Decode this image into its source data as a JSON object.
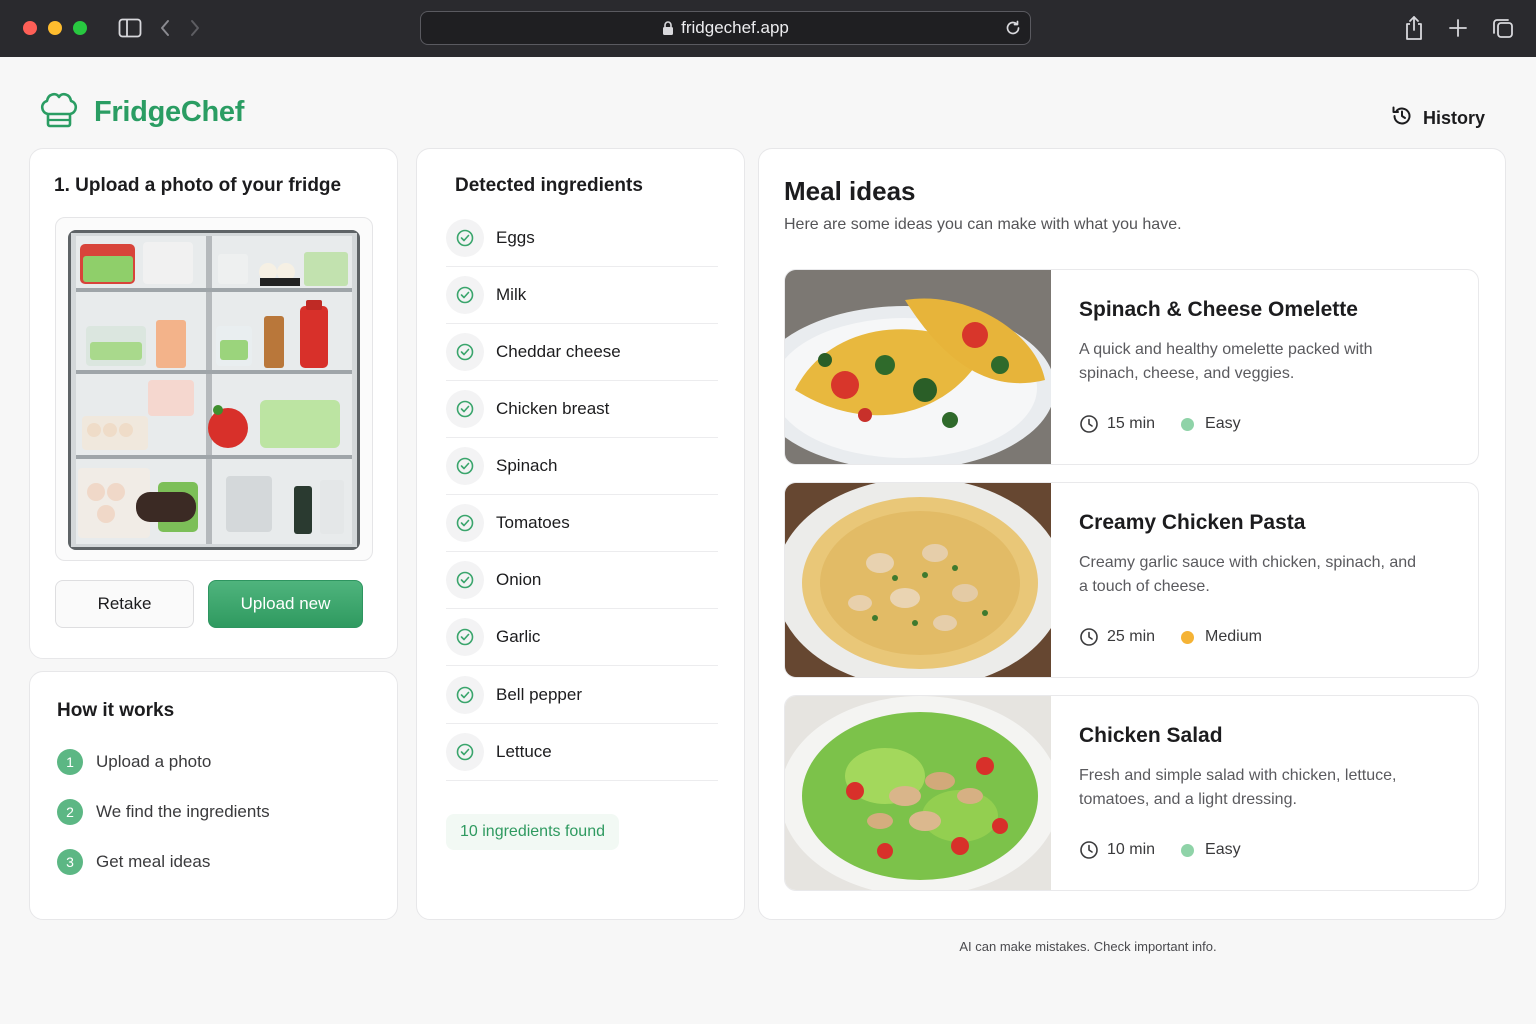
{
  "browser": {
    "url": "fridgechef.app"
  },
  "header": {
    "brand": "FridgeChef",
    "history_label": "History"
  },
  "upload": {
    "title": "1. Upload a photo of your fridge",
    "retake_label": "Retake",
    "upload_label": "Upload new"
  },
  "how": {
    "title": "How it works",
    "steps": [
      {
        "num": "1",
        "label": "Upload a photo"
      },
      {
        "num": "2",
        "label": "We find the ingredients"
      },
      {
        "num": "3",
        "label": "Get meal ideas"
      }
    ]
  },
  "ingredients": {
    "title": "Detected ingredients",
    "items": [
      "Eggs",
      "Milk",
      "Cheddar cheese",
      "Chicken breast",
      "Spinach",
      "Tomatoes",
      "Onion",
      "Garlic",
      "Bell pepper",
      "Lettuce"
    ],
    "found_label": "10 ingredients found"
  },
  "meals": {
    "title": "Meal ideas",
    "subtitle": "Here are some ideas you can make with what you have.",
    "items": [
      {
        "title": "Spinach & Cheese Omelette",
        "desc": "A quick and healthy omelette packed with spinach, cheese, and veggies.",
        "time": "15 min",
        "difficulty": "Easy",
        "difficulty_color": "#8fd3a8"
      },
      {
        "title": "Creamy Chicken Pasta",
        "desc": "Creamy garlic sauce with chicken, spinach, and a touch of cheese.",
        "time": "25 min",
        "difficulty": "Medium",
        "difficulty_color": "#f5b335"
      },
      {
        "title": "Chicken Salad",
        "desc": "Fresh and simple salad with chicken, lettuce, tomatoes, and a light dressing.",
        "time": "10 min",
        "difficulty": "Easy",
        "difficulty_color": "#8fd3a8"
      }
    ]
  },
  "footer": {
    "note": "AI can make mistakes. Check important info."
  },
  "colors": {
    "brand_green": "#2a9d63",
    "check_green": "#3aa56c"
  }
}
